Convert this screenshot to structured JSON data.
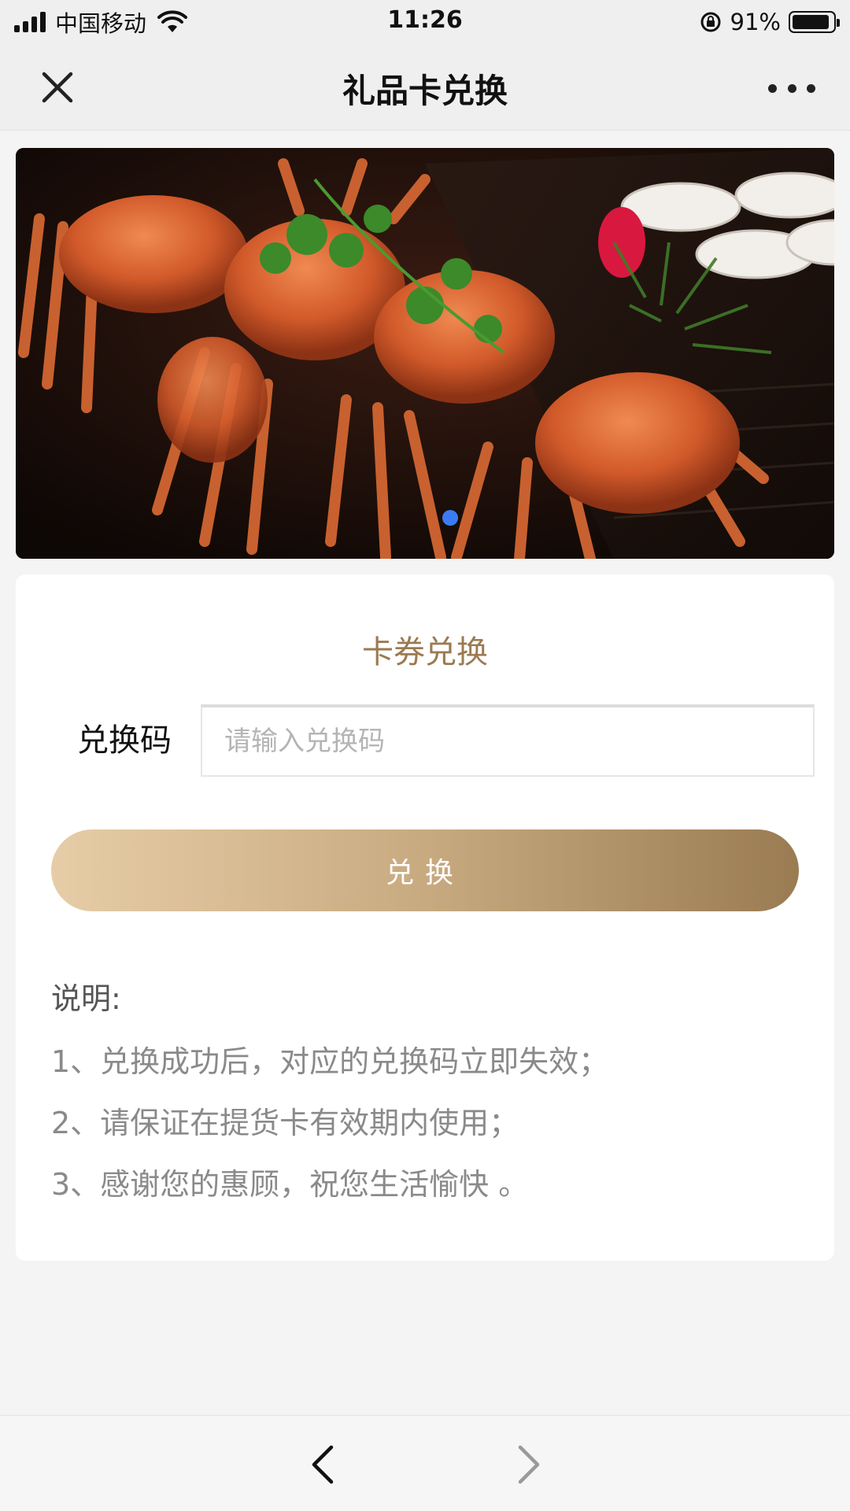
{
  "status_bar": {
    "carrier": "中国移动",
    "time": "11:26",
    "battery": "91%",
    "battery_level": 0.91
  },
  "nav": {
    "title": "礼品卡兑换",
    "close_icon": "close-icon",
    "more_icon": "more-icon"
  },
  "banner": {
    "image": "steamed-crabs-photo",
    "page_indicator": {
      "count": 1,
      "active": 1,
      "color": "#3b7cf5"
    }
  },
  "redeem": {
    "title": "卡券兑换",
    "code_label": "兑换码",
    "code_value": "",
    "code_placeholder": "请输入兑换码",
    "button_label": "兑换"
  },
  "notes": {
    "heading": "说明:",
    "items": [
      "1、兑换成功后，对应的兑换码立即失效；",
      "2、请保证在提货卡有效期内使用；",
      "3、感谢您的惠顾，祝您生活愉快 。"
    ]
  },
  "bottom_nav": {
    "back_icon": "chevron-left-icon",
    "forward_icon": "chevron-right-icon"
  },
  "colors": {
    "accent_gold": "#9b7a4f",
    "button_gradient": [
      "#e6cda7",
      "#9a7b52"
    ],
    "page_bg": "#f4f4f4"
  }
}
